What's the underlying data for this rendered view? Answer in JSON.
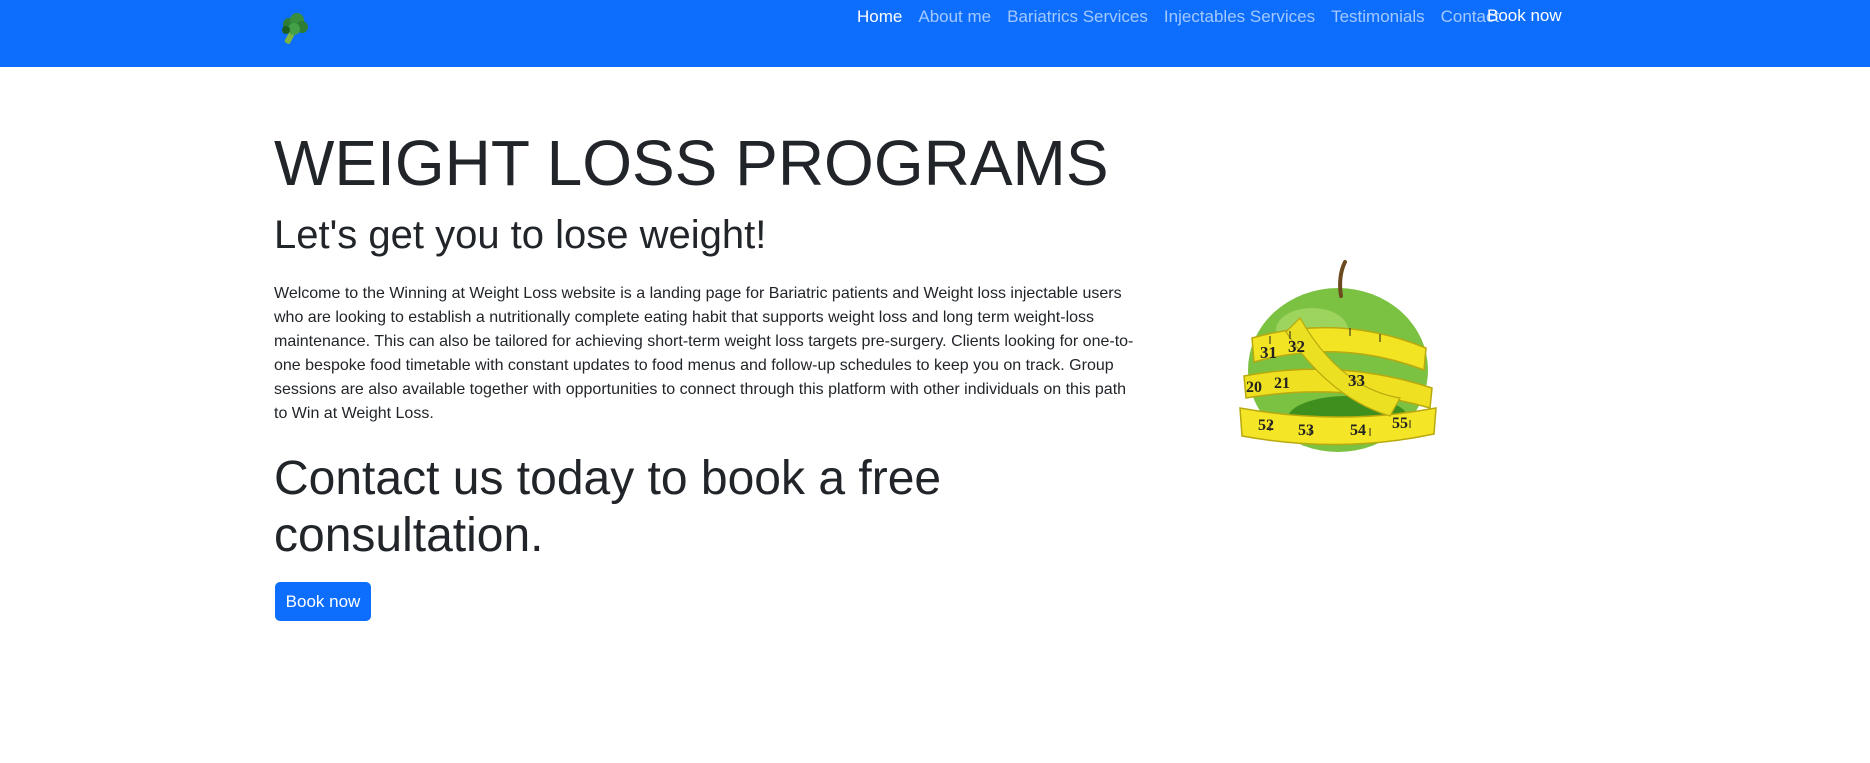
{
  "nav": {
    "logo_icon": "broccoli-icon",
    "links": [
      {
        "label": "Home",
        "active": true
      },
      {
        "label": "About me",
        "active": false
      },
      {
        "label": "Bariatrics Services",
        "active": false
      },
      {
        "label": "Injectables Services",
        "active": false
      },
      {
        "label": "Testimonials",
        "active": false
      },
      {
        "label": "Contact",
        "active": false
      }
    ],
    "book_label": "Book now"
  },
  "hero": {
    "title": "WEIGHT LOSS PROGRAMS",
    "subtitle": "Let's get you to lose weight!",
    "text": "Welcome to the Winning at Weight Loss website is a landing page for Bariatric patients and Weight loss injectable users who are looking to establish a nutritionally complete eating habit that supports weight loss and long term weight-loss maintenance. This can also be tailored for achieving short-term weight loss targets pre-surgery. Clients looking for one-to-one bespoke food timetable with constant updates to food menus and follow-up schedules to keep you on track. Group sessions are also available together with opportunities to connect through this platform with other individuals on this path to Win at Weight Loss.",
    "cta_heading": "Contact us today to book a free consultation.",
    "button_label": "Book now",
    "image_icon": "apple-measuring-tape-image",
    "tape_numbers": [
      "31",
      "32",
      "33",
      "20",
      "21",
      "52",
      "53",
      "54",
      "55"
    ]
  },
  "colors": {
    "primary": "#0d6efd",
    "text": "#212529",
    "background": "#ffffff"
  }
}
